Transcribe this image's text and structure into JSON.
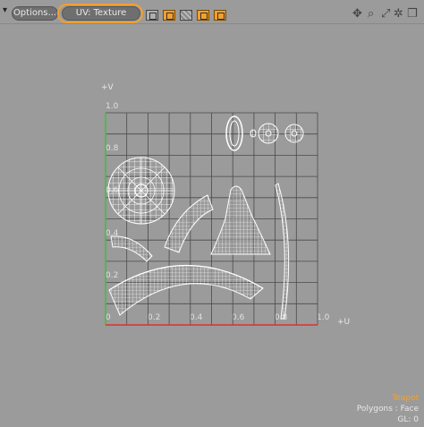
{
  "toolbar": {
    "menu_caret": "▾",
    "options_label": "Options...",
    "uv_label": "UV: Texture",
    "view_buttons": [
      "frame-icon",
      "uv-border-icon",
      "checker-icon",
      "sync-icon",
      "lock-icon"
    ],
    "nav_icons": [
      "move-icon",
      "zoom-icon",
      "maximize-icon",
      "settings-icon",
      "restore-icon"
    ]
  },
  "viewport": {
    "v_axis_label": "+V",
    "u_axis_label": "+U",
    "tick_labels_v": [
      "1.0",
      "0.8",
      "0.6",
      "0.4",
      "0.2",
      "0"
    ],
    "tick_labels_u": [
      "0.2",
      "0.4",
      "0.6",
      "0.8",
      "1.0"
    ],
    "v_axis_color": "#3fbf3f",
    "u_axis_color": "#e03030",
    "mesh_color": "#ffffff"
  },
  "status": {
    "item_name": "Teapot",
    "selection_mode": "Polygons : Face",
    "gl_info": "GL: 0",
    "item_color": "#f0a030",
    "info_color": "#e8e8e8"
  }
}
